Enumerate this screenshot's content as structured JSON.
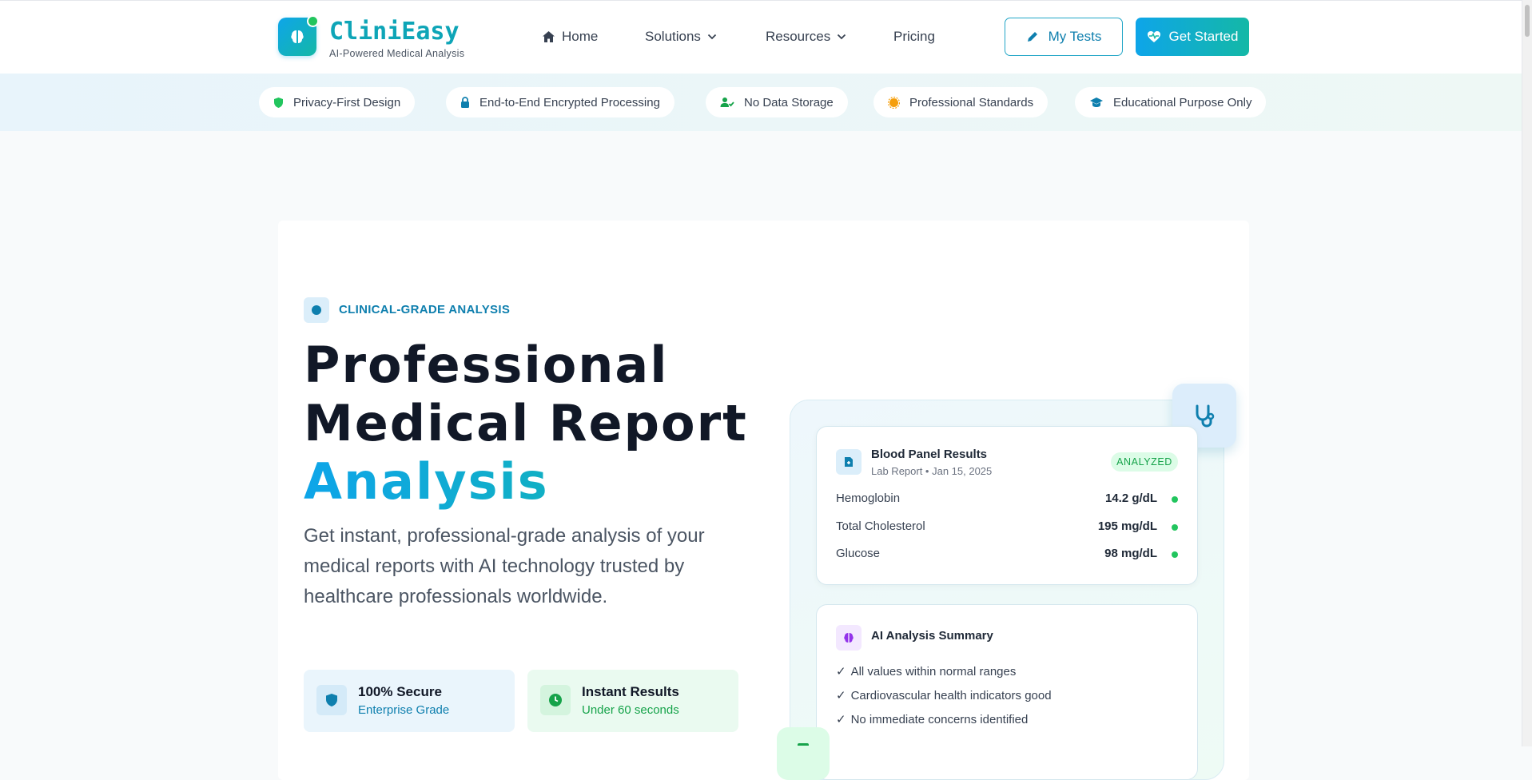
{
  "brand": {
    "name": "CliniEasy",
    "tagline": "AI-Powered Medical Analysis"
  },
  "nav": {
    "home": "Home",
    "solutions": "Solutions",
    "resources": "Resources",
    "pricing": "Pricing"
  },
  "header_actions": {
    "my_tests": "My Tests",
    "get_started": "Get Started"
  },
  "trust": [
    {
      "label": "Privacy-First Design",
      "icon": "shield-icon"
    },
    {
      "label": "End-to-End Encrypted Processing",
      "icon": "lock-icon"
    },
    {
      "label": "No Data Storage",
      "icon": "user-check-icon"
    },
    {
      "label": "Professional Standards",
      "icon": "badge-icon"
    },
    {
      "label": "Educational Purpose Only",
      "icon": "graduation-cap-icon"
    }
  ],
  "hero": {
    "eyebrow": "CLINICAL-GRADE ANALYSIS",
    "title_line1": "Professional",
    "title_line2": "Medical Report",
    "title_line3": "Analysis",
    "description": "Get instant, professional-grade analysis of your medical reports with AI technology trusted by healthcare professionals worldwide."
  },
  "features": [
    {
      "title": "100% Secure",
      "subtitle": "Enterprise Grade"
    },
    {
      "title": "Instant Results",
      "subtitle": "Under 60 seconds"
    }
  ],
  "report_card": {
    "title": "Blood Panel Results",
    "subtitle": "Lab Report • Jan 15, 2025",
    "status": "ANALYZED",
    "metrics": [
      {
        "name": "Hemoglobin",
        "value": "14.2 g/dL"
      },
      {
        "name": "Total Cholesterol",
        "value": "195 mg/dL"
      },
      {
        "name": "Glucose",
        "value": "98 mg/dL"
      }
    ]
  },
  "summary_card": {
    "title": "AI Analysis Summary",
    "items": [
      "All values within normal ranges",
      "Cardiovascular health indicators good",
      "No immediate concerns identified"
    ]
  },
  "colors": {
    "primary": "#0ea5e9",
    "teal": "#14b8a6",
    "success": "#22c55e",
    "text": "#111827"
  }
}
